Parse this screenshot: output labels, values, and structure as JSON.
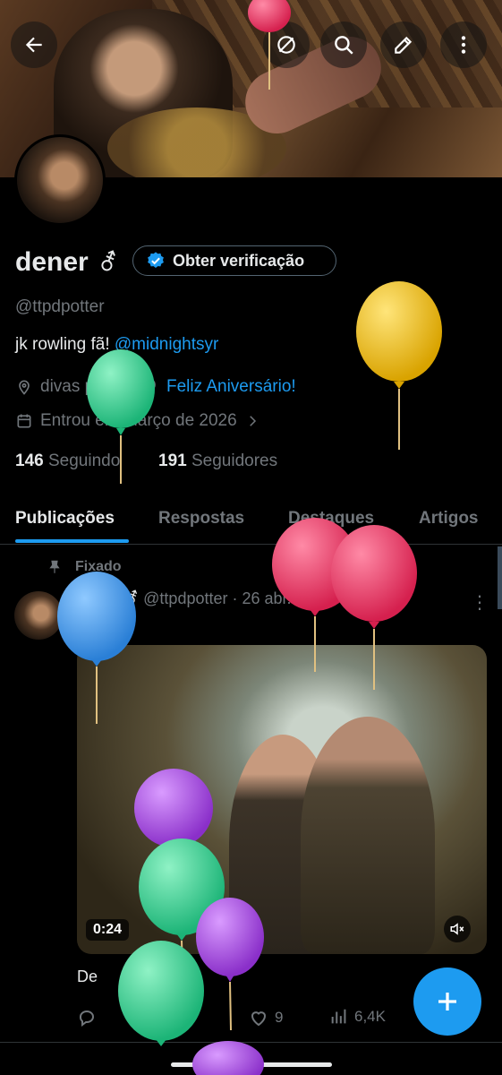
{
  "profile": {
    "name": "dener",
    "gender_symbol": "⚦",
    "verify_label": "Obter verificação",
    "handle": "@ttpdpotter",
    "bio_text": "jk rowling fã!",
    "bio_mention": "@midnightsyr",
    "location": "divas pop",
    "birthday_link": "Feliz Aniversário!",
    "joined": "Entrou em março de 2026",
    "following_count": "146",
    "following_label": "Seguindo",
    "followers_count": "191",
    "followers_label": "Seguidores"
  },
  "tabs": [
    {
      "label": "Publicações",
      "active": true
    },
    {
      "label": "Respostas",
      "active": false
    },
    {
      "label": "Destaques",
      "active": false
    },
    {
      "label": "Artigos",
      "active": false
    }
  ],
  "post": {
    "pinned_label": "Fixado",
    "author_name": "dener",
    "author_symbol": "⚦",
    "author_handle": "@ttpdpotter",
    "date": "· 26 abr.",
    "video_duration": "0:24",
    "caption": "De",
    "likes": "9",
    "views": "6,4K"
  },
  "colors": {
    "accent": "#1d9bf0",
    "balloon_yellow": "#f2c21b",
    "balloon_green": "#2fd18f",
    "balloon_pink": "#f03e6a",
    "balloon_blue": "#3a9ef0",
    "balloon_purple": "#b04ee8"
  },
  "icons": [
    "back-arrow-icon",
    "circle-slash-icon",
    "search-icon",
    "edit-icon",
    "more-vertical-icon",
    "verified-badge-icon",
    "location-icon",
    "balloon-icon",
    "calendar-icon",
    "chevron-right-icon",
    "pin-icon",
    "reply-icon",
    "retweet-icon",
    "heart-icon",
    "views-icon",
    "plus-icon",
    "mute-icon"
  ]
}
